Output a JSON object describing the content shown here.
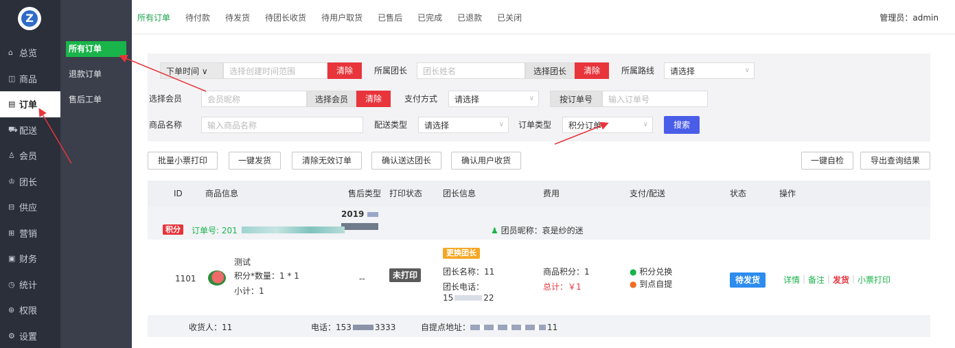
{
  "sidebar": {
    "logo": "Z",
    "items": [
      {
        "icon": "⌂",
        "label": "总览"
      },
      {
        "icon": "◫",
        "label": "商品"
      },
      {
        "icon": "▤",
        "label": "订单"
      },
      {
        "icon": "⛟",
        "label": "配送"
      },
      {
        "icon": "♙",
        "label": "会员"
      },
      {
        "icon": "♔",
        "label": "团长"
      },
      {
        "icon": "⊟",
        "label": "供应"
      },
      {
        "icon": "⊞",
        "label": "营销"
      },
      {
        "icon": "▣",
        "label": "财务"
      },
      {
        "icon": "◷",
        "label": "统计"
      },
      {
        "icon": "⊛",
        "label": "权限"
      },
      {
        "icon": "⚙",
        "label": "设置"
      }
    ],
    "active_index": 2
  },
  "subnav": {
    "items": [
      "所有订单",
      "退款订单",
      "售后工单"
    ],
    "active_index": 0
  },
  "topbar": {
    "tabs": [
      "所有订单",
      "待付款",
      "待发货",
      "待团长收货",
      "待用户取货",
      "已售后",
      "已完成",
      "已退款",
      "已关闭"
    ],
    "admin": "管理员：admin"
  },
  "filters": {
    "time_select": "下单时间 ∨",
    "time_placeholder": "选择创建时间范围",
    "clear": "清除",
    "leader_label": "所属团长",
    "leader_placeholder": "团长姓名",
    "choose_leader": "选择团长",
    "route_label": "所属路线",
    "route_value": "请选择",
    "member_label": "选择会员",
    "member_placeholder": "会员昵称",
    "choose_member": "选择会员",
    "pay_label": "支付方式",
    "pay_value": "请选择",
    "orderno_btn": "按订单号",
    "orderno_placeholder": "输入订单号",
    "goods_label": "商品名称",
    "goods_placeholder": "输入商品名称",
    "delivery_label": "配送类型",
    "delivery_value": "请选择",
    "ordertype_label": "订单类型",
    "ordertype_value": "积分订单",
    "search": "搜索"
  },
  "actions": {
    "batch_print": "批量小票打印",
    "one_ship": "一键发货",
    "clear_invalid": "清除无效订单",
    "confirm_leader": "确认送达团长",
    "confirm_user": "确认用户收货",
    "self_check": "一键自检",
    "export": "导出查询结果"
  },
  "table": {
    "headers": [
      "ID",
      "商品信息",
      "售后类型",
      "打印状态",
      "团长信息",
      "费用",
      "支付/配送",
      "状态",
      "操作"
    ]
  },
  "order": {
    "date": "2019",
    "badge": "积分",
    "order_no": "订单号: 201",
    "member_nick": "团员昵称：哀是纱的迷",
    "id": "1101",
    "goods_name": "测试",
    "goods_qty": "积分*数量：1 * 1",
    "goods_subtotal": "小计：1",
    "aftersale": "--",
    "print_status": "未打印",
    "change_leader": "更换团长",
    "leader_name": "团长名称：11",
    "leader_phone_label": "团长电话：",
    "leader_phone_a": "15",
    "leader_phone_b": "22",
    "fee_points": "商品积分：1",
    "fee_total": "总计：￥1",
    "pay_type": "积分兑换",
    "delivery_type": "到点自提",
    "status": "待发货",
    "ops": [
      "详情",
      "备注",
      "发货",
      "小票打印"
    ],
    "receiver": "收货人：11",
    "phone_a": "电话：153",
    "phone_b": "3333",
    "pickup_label": "自提点地址：",
    "pickup_tail": "11"
  },
  "colors": {
    "accent_green": "#19b44a",
    "danger_red": "#e8343b",
    "primary_blue": "#4a5de8",
    "status_blue": "#2d8cf0",
    "sidebar_dark": "#2b2f3a"
  }
}
